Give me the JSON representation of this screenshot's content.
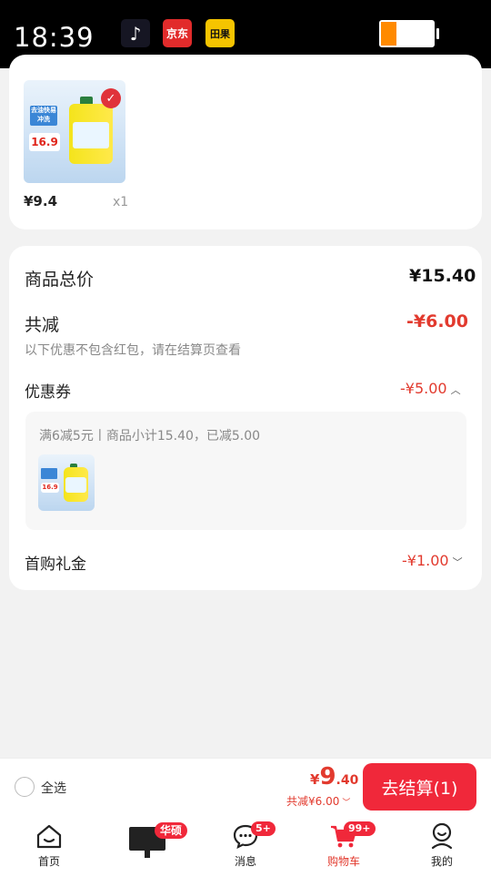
{
  "status_bar": {
    "time": "18:39",
    "apps": [
      "tiktok-icon",
      "jd-icon",
      "meituan-icon"
    ],
    "app_labels": {
      "jd": "京东",
      "meituan": "田果"
    },
    "battery_level": 0.3
  },
  "item": {
    "price": "¥9.4",
    "qty": "x1",
    "image_text": {
      "tag": "去油快易冲洗",
      "price": "16.9"
    }
  },
  "summary": {
    "total_label": "商品总价",
    "total_value": "¥15.40",
    "discount_label": "共减",
    "discount_value": "-¥6.00",
    "discount_note": "以下优惠不包含红包，请在结算页查看",
    "coupon_label": "优惠券",
    "coupon_value": "-¥5.00",
    "coupon_detail": "满6减5元丨商品小计15.40，已减5.00",
    "first_label": "首购礼金",
    "first_value": "-¥1.00"
  },
  "checkout": {
    "select_all": "全选",
    "currency": "¥",
    "price_int": "9",
    "price_dec": ".40",
    "discount": "共减¥6.00",
    "button": "去结算(1)"
  },
  "tabbar": {
    "home": "首页",
    "ad_badge": "华硕",
    "messages": "消息",
    "messages_badge": "5+",
    "cart": "购物车",
    "cart_badge": "99+",
    "me": "我的"
  },
  "colors": {
    "accent": "#f0283a",
    "price_red": "#e23a2e"
  }
}
